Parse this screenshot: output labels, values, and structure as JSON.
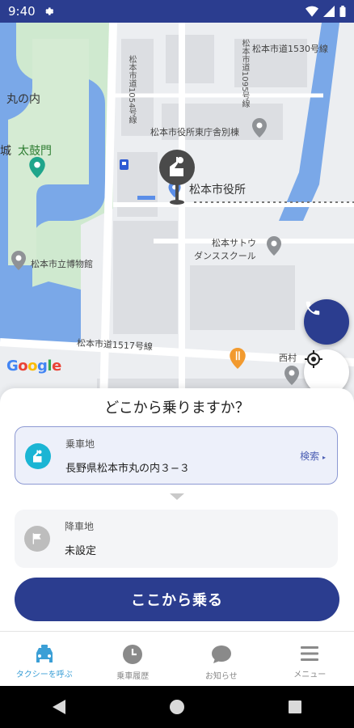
{
  "status_bar": {
    "time": "9:40"
  },
  "map": {
    "labels": {
      "road_1530": "松本市道1530号線",
      "road_1054": "松本市道1054号線",
      "road_1095": "松本市道1095号線",
      "road_1517": "松本市道1517号線",
      "marunouchi": "丸の内",
      "taikomon": "太鼓門",
      "jo_fragment": "城",
      "annex": "松本市役所東庁舎別棟",
      "city_hall": "松本市役所",
      "dance_line1": "松本サトウ",
      "dance_line2": "ダンススクール",
      "museum": "松本市立博物館",
      "nishimura": "西村"
    },
    "colors": {
      "water": "#7aa8e8",
      "park": "#c8e6c9",
      "accent": "#2b3d8f"
    }
  },
  "sheet": {
    "title": "どこから乗りますか？",
    "pickup": {
      "label": "乗車地",
      "value": "長野県松本市丸の内３−３",
      "search_label": "検索"
    },
    "dropoff": {
      "label": "降車地",
      "value": "未設定"
    },
    "ride_button": "ここから乗る"
  },
  "nav": {
    "items": [
      {
        "label": "タクシーを呼ぶ",
        "icon": "taxi-icon"
      },
      {
        "label": "乗車履歴",
        "icon": "clock-icon"
      },
      {
        "label": "お知らせ",
        "icon": "chat-icon"
      },
      {
        "label": "メニュー",
        "icon": "menu-icon"
      }
    ]
  }
}
